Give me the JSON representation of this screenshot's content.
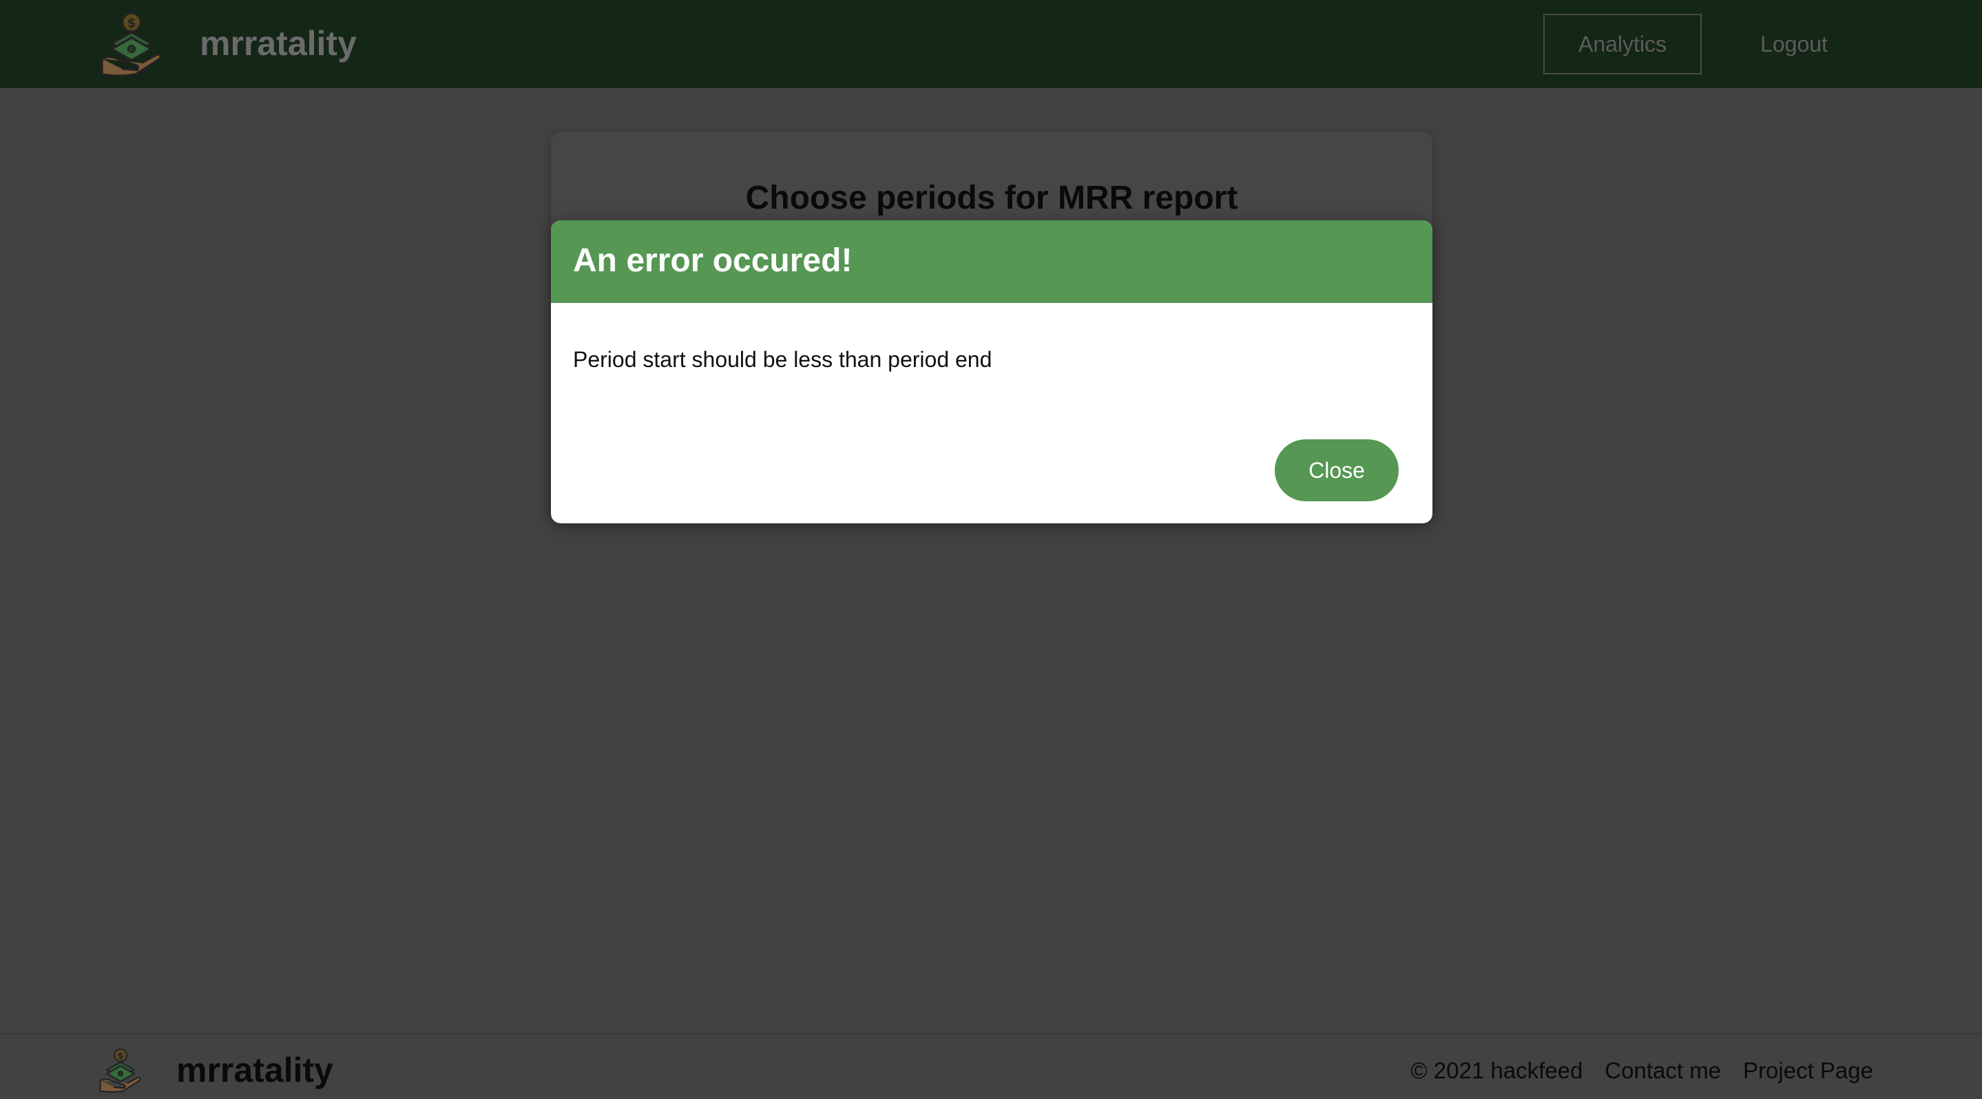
{
  "header": {
    "brand": "mrratality",
    "nav": {
      "analytics_label": "Analytics",
      "logout_label": "Logout"
    }
  },
  "main": {
    "card_title": "Choose periods for MRR report"
  },
  "modal": {
    "title": "An error occured!",
    "message": "Period start should be less than period end",
    "close_label": "Close"
  },
  "footer": {
    "brand": "mrratality",
    "copyright": "© 2021 hackfeed",
    "contact_label": "Contact me",
    "project_label": "Project Page"
  },
  "colors": {
    "header_bg": "#142615",
    "page_overlay": "#424242",
    "accent_green": "#559753",
    "modal_bg": "#ffffff"
  },
  "icons": {
    "logo": "money-hand-logo-icon"
  }
}
